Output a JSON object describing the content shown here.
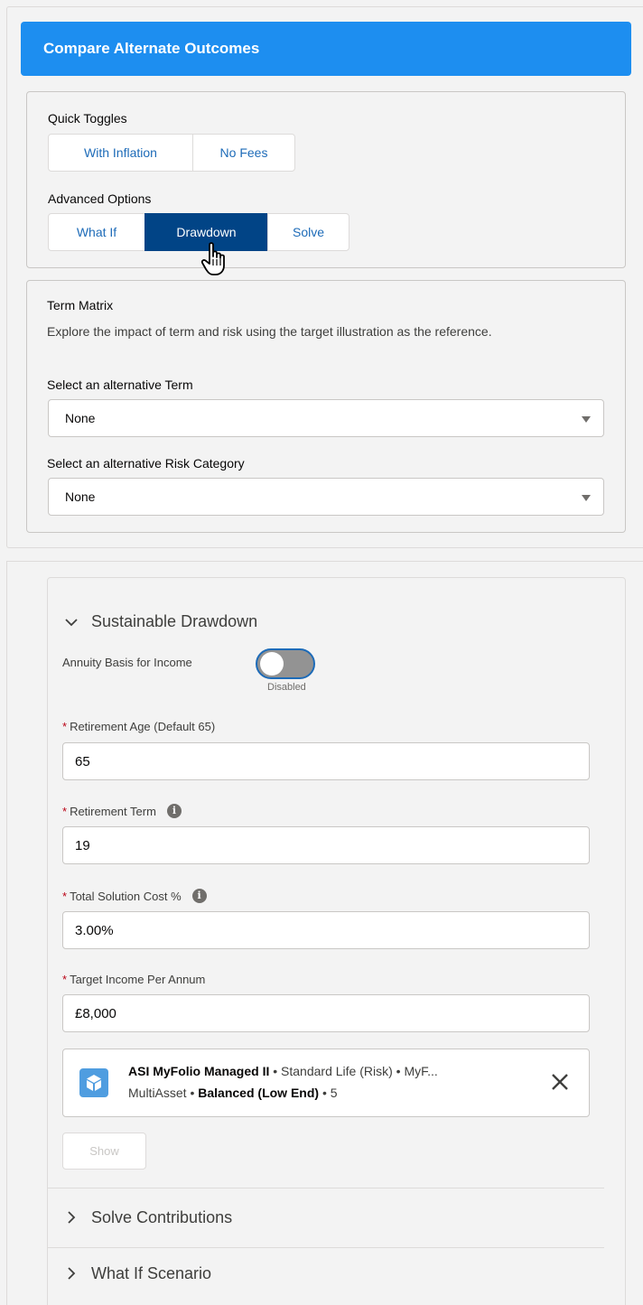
{
  "header": {
    "title": "Compare Alternate Outcomes"
  },
  "quick_toggles": {
    "title": "Quick Toggles",
    "buttons": [
      "With Inflation",
      "No Fees"
    ]
  },
  "advanced_options": {
    "title": "Advanced Options",
    "buttons": [
      "What If",
      "Drawdown",
      "Solve"
    ],
    "active": "Drawdown"
  },
  "term_matrix": {
    "title": "Term Matrix",
    "description": "Explore the impact of term and risk using the target illustration as the reference.",
    "term_label": "Select an alternative Term",
    "term_value": "None",
    "risk_label": "Select an alternative Risk Category",
    "risk_value": "None"
  },
  "sustainable_drawdown": {
    "title": "Sustainable Drawdown",
    "annuity_label": "Annuity Basis for Income",
    "annuity_state": "Disabled",
    "fields": [
      {
        "label": "Retirement Age (Default 65)",
        "value": "65"
      },
      {
        "label": "Retirement Term",
        "value": "19"
      },
      {
        "label": "Total Solution Cost %",
        "value": "3.00%"
      },
      {
        "label": "Target Income Per Annum",
        "value": "£8,000"
      }
    ],
    "required_marker": "*",
    "info_glyph": "i",
    "fund": {
      "name": "ASI MyFolio Managed II",
      "provider": " • Standard Life (Risk) • MyF...",
      "line2_prefix": "MultiAsset • ",
      "risk": "Balanced (Low End)",
      "line2_suffix": " • 5"
    },
    "show_label": "Show"
  },
  "sections": {
    "solve": "Solve Contributions",
    "what_if": "What If Scenario"
  },
  "colors": {
    "header": "#1d8ef0",
    "active_button": "#014486",
    "link": "#1d6bb8"
  }
}
